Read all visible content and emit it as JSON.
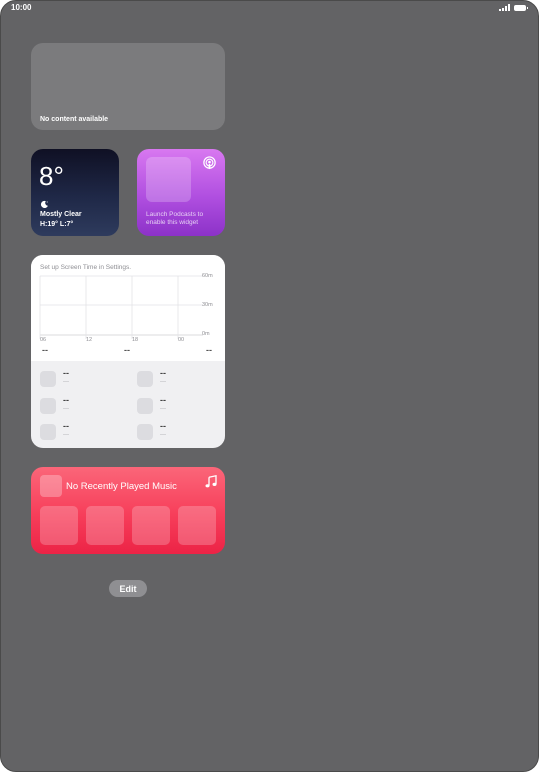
{
  "status_bar": {
    "time": "10:00"
  },
  "empty_widget": {
    "message": "No content available"
  },
  "weather": {
    "temperature": "8°",
    "condition": "Mostly Clear",
    "high_low": "H:19° L:7°"
  },
  "podcasts": {
    "message": "Launch Podcasts to enable this widget"
  },
  "screen_time": {
    "header": "Set up Screen Time in Settings.",
    "x_ticks": [
      "06",
      "12",
      "18",
      "00"
    ],
    "y_ticks": [
      "60m",
      "30m",
      "0m"
    ],
    "summary": [
      "--",
      "--",
      "--"
    ],
    "items": [
      {
        "value": "--",
        "sub": "---"
      },
      {
        "value": "--",
        "sub": "---"
      },
      {
        "value": "--",
        "sub": "---"
      },
      {
        "value": "--",
        "sub": "---"
      },
      {
        "value": "--",
        "sub": "---"
      },
      {
        "value": "--",
        "sub": "---"
      }
    ]
  },
  "music": {
    "title": "No Recently Played Music"
  },
  "edit_button": {
    "label": "Edit"
  },
  "colors": {
    "wallpaper": "#636365",
    "podcasts_accent": "#b04fe0",
    "music_accent": "#f73e5a",
    "weather_bg": "#1f2847"
  }
}
